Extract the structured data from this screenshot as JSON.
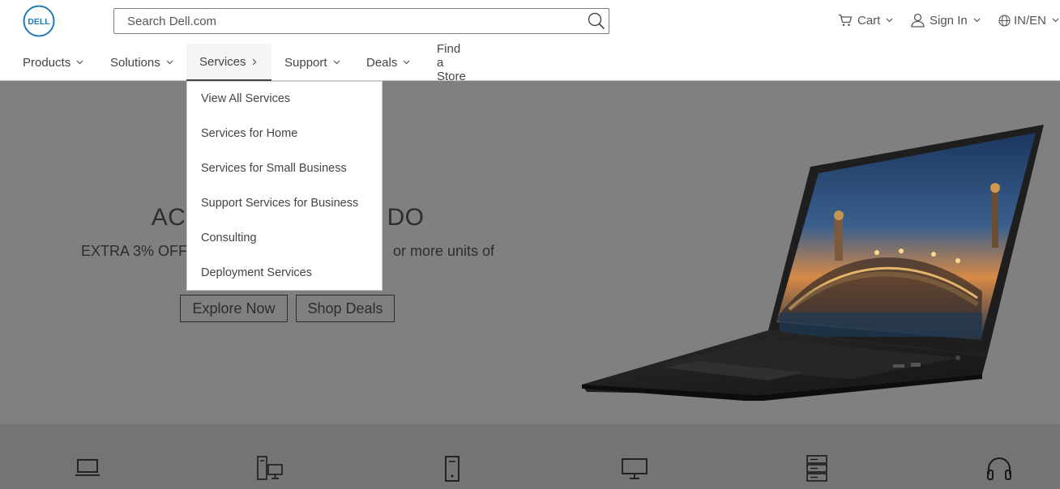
{
  "header": {
    "logo_text": "DELL",
    "search": {
      "placeholder": "Search Dell.com",
      "value": ""
    },
    "cart_label": "Cart",
    "signin_label": "Sign In",
    "locale_label": "IN/EN"
  },
  "nav": {
    "items": [
      {
        "label": "Products",
        "icon": "chevron-down-icon"
      },
      {
        "label": "Solutions",
        "icon": "chevron-down-icon"
      },
      {
        "label": "Services",
        "icon": "chevron-right-icon",
        "active": true
      },
      {
        "label": "Support",
        "icon": "chevron-down-icon"
      },
      {
        "label": "Deals",
        "icon": "chevron-down-icon"
      },
      {
        "label": "Find a Store"
      }
    ]
  },
  "services_menu": {
    "items": [
      {
        "label": "View All Services"
      },
      {
        "label": "Services for Home"
      },
      {
        "label": "Services for Small Business"
      },
      {
        "label": "Support Services for Business"
      },
      {
        "label": "Consulting"
      },
      {
        "label": "Deployment Services"
      }
    ]
  },
  "hero": {
    "title_left": "ACC",
    "title_right": "U DO",
    "subtitle_left": "EXTRA 3% OFF",
    "subtitle_right": "or more units of",
    "explore_label": "Explore Now",
    "shop_label": "Shop Deals",
    "image": "laptop-image"
  },
  "categories": {
    "icons": [
      "laptop-icon",
      "desktop-workstation-icon",
      "tower-icon",
      "monitor-icon",
      "server-icon",
      "headset-icon"
    ]
  },
  "colors": {
    "hero_bg": "#808080",
    "band_bg": "#747474",
    "logo_blue": "#1f7ab5"
  }
}
